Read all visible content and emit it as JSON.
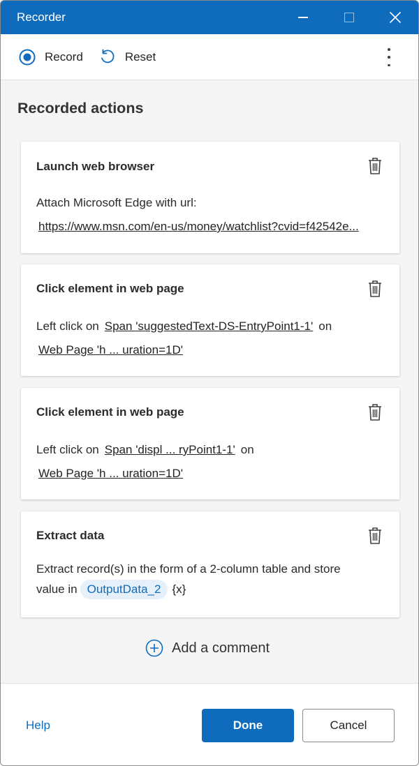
{
  "window": {
    "title": "Recorder"
  },
  "toolbar": {
    "record_label": "Record",
    "reset_label": "Reset"
  },
  "main": {
    "section_title": "Recorded actions",
    "actions": [
      {
        "title": "Launch web browser",
        "text": "Attach Microsoft Edge with url:",
        "url": "https://www.msn.com/en-us/money/watchlist?cvid=f42542e..."
      },
      {
        "title": "Click element in web page",
        "prefix": "Left click on",
        "element": "Span 'suggestedText-DS-EntryPoint1-1'",
        "on": "on",
        "page": "Web Page 'h ... uration=1D'"
      },
      {
        "title": "Click element in web page",
        "prefix": "Left click on",
        "element": "Span 'displ ... ryPoint1-1'",
        "on": "on",
        "page": "Web Page 'h ... uration=1D'"
      },
      {
        "title": "Extract data",
        "line1": "Extract record(s) in the form of a 2-column table and store",
        "line2_prefix": "value in",
        "variable": "OutputData_2",
        "variable_icon": "{x}"
      }
    ],
    "add_comment_label": "Add a comment"
  },
  "footer": {
    "help_label": "Help",
    "done_label": "Done",
    "cancel_label": "Cancel"
  },
  "colors": {
    "accent": "#0f6cbd",
    "variable_bg": "#e5f0fb"
  }
}
